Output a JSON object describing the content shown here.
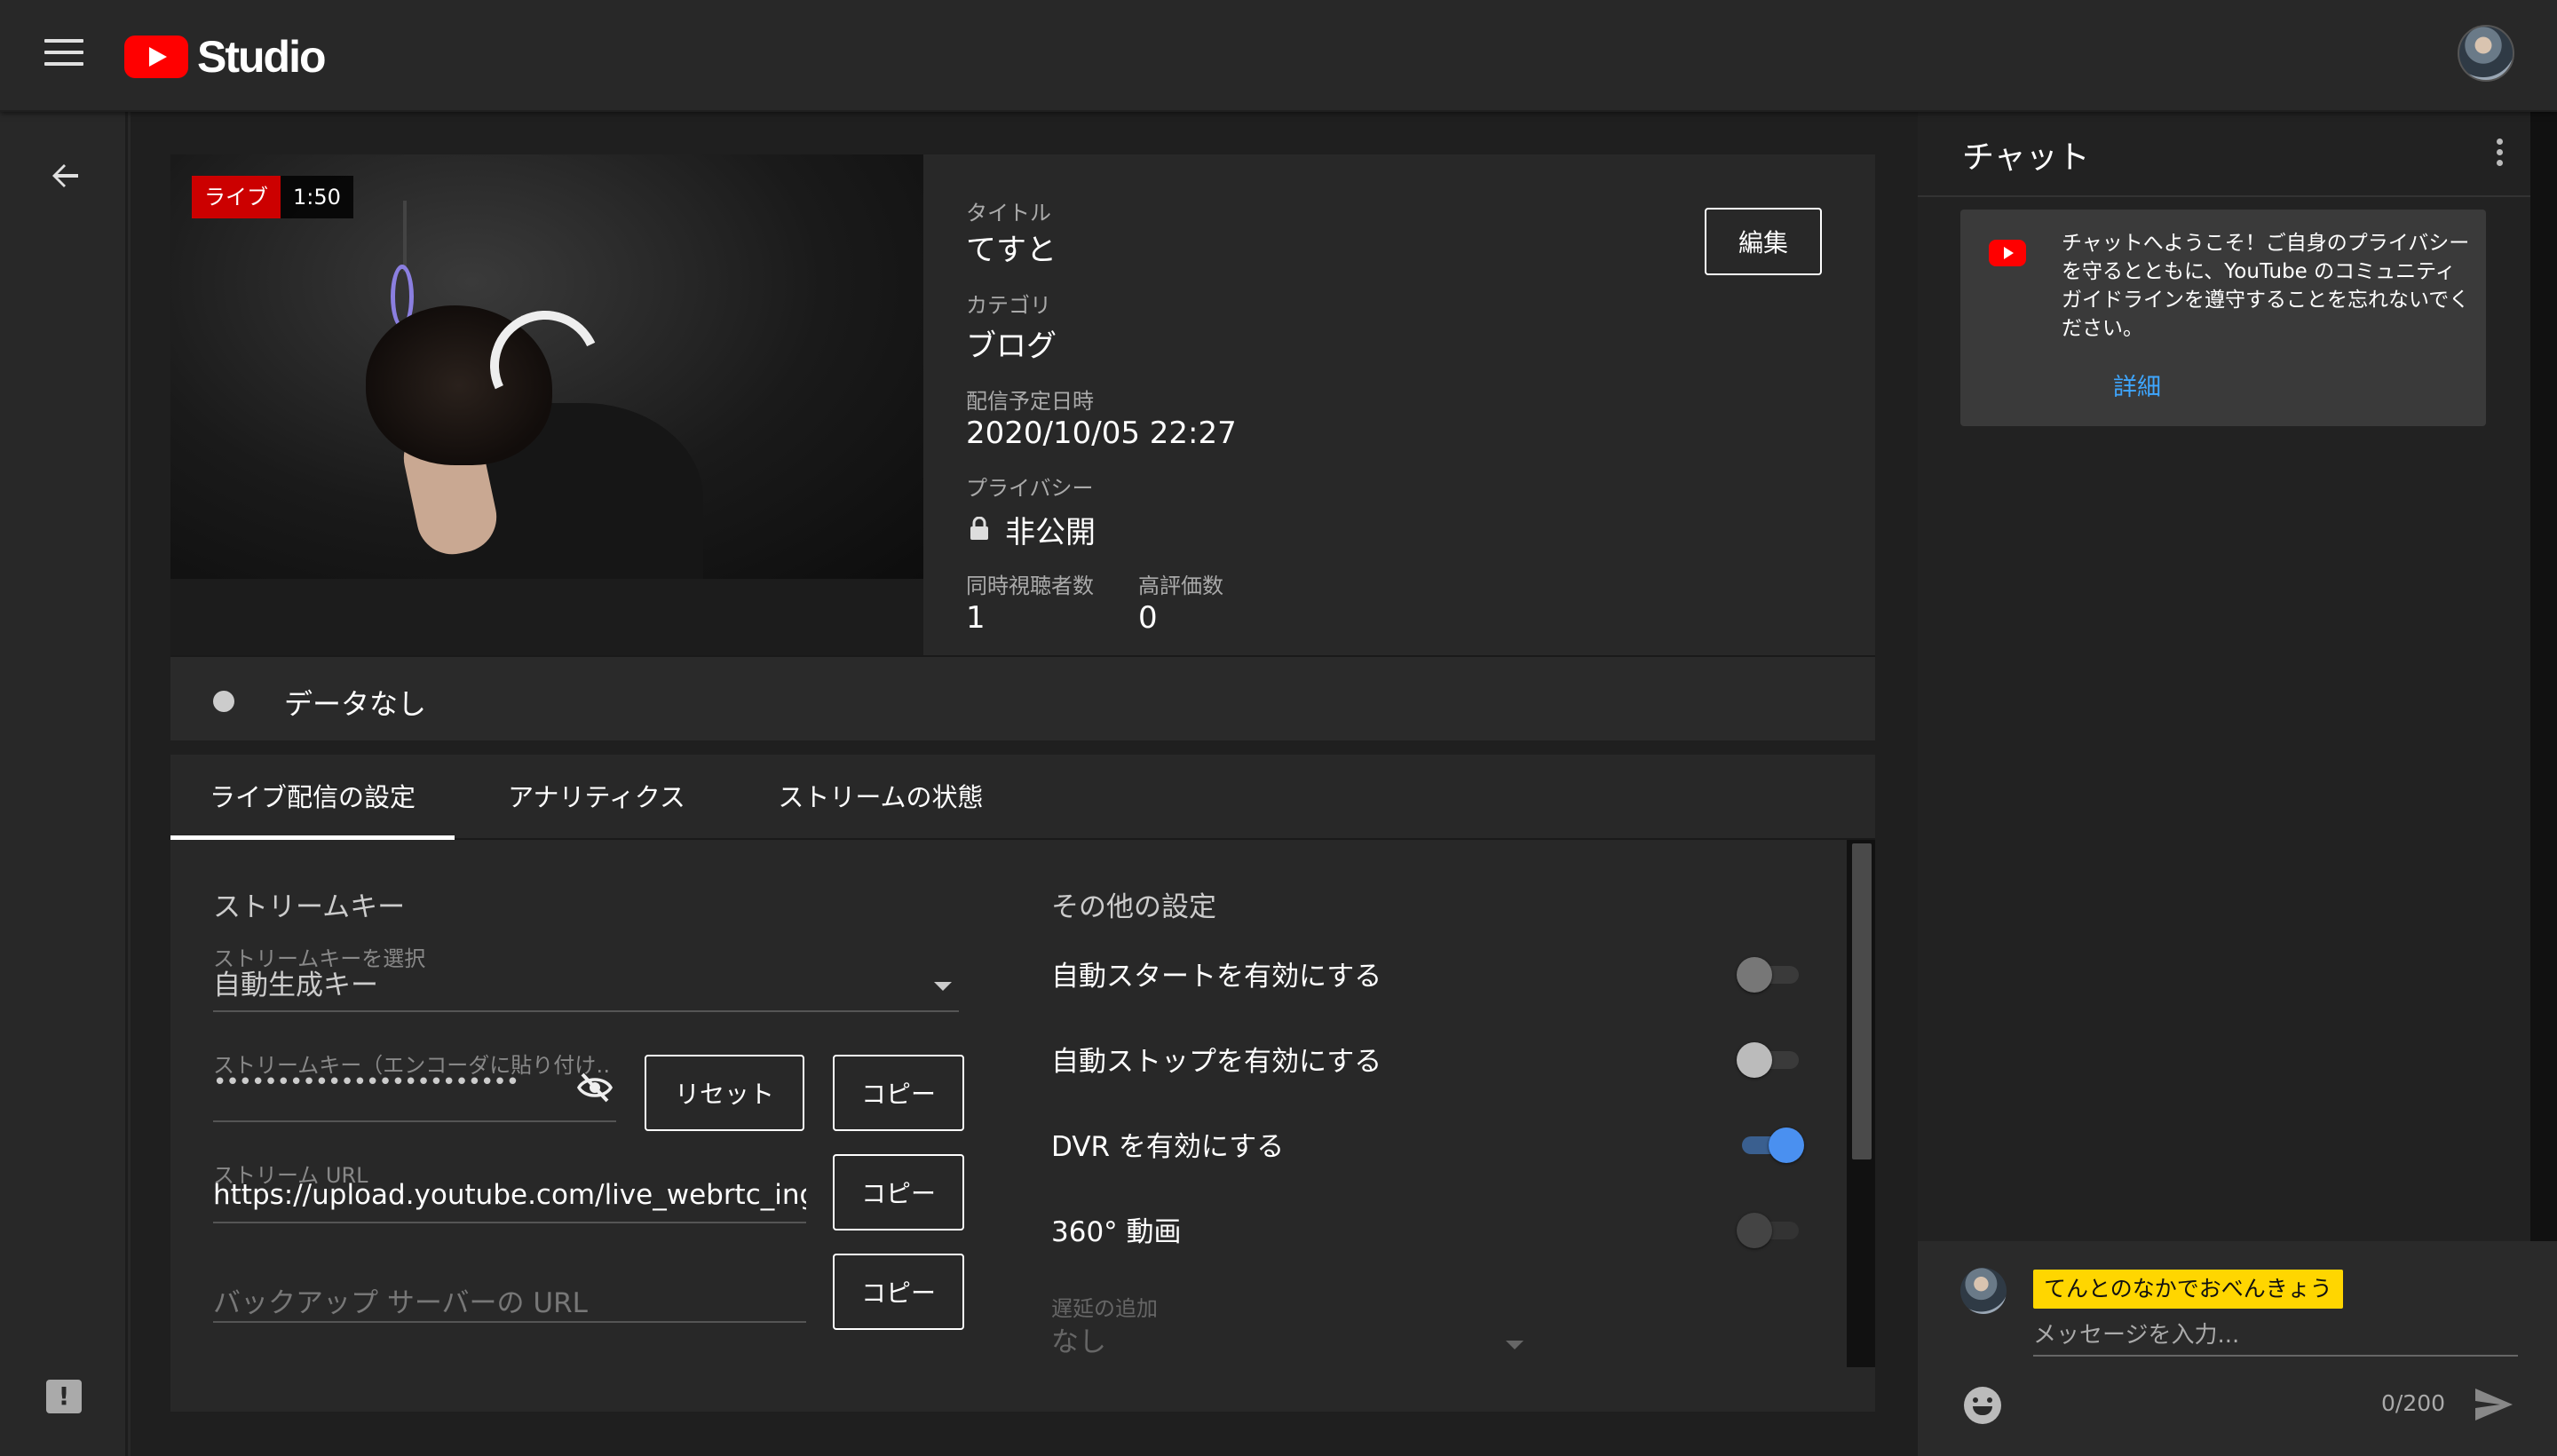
{
  "app": {
    "logo_text": "Studio"
  },
  "preview": {
    "live_label": "ライブ",
    "live_time": "1:50"
  },
  "info": {
    "title_label": "タイトル",
    "title_value": "てすと",
    "category_label": "カテゴリ",
    "category_value": "ブログ",
    "schedule_label": "配信予定日時",
    "schedule_value": "2020/10/05 22:27",
    "privacy_label": "プライバシー",
    "privacy_value": "非公開",
    "viewers_label": "同時視聴者数",
    "viewers_value": "1",
    "likes_label": "高評価数",
    "likes_value": "0",
    "edit_label": "編集"
  },
  "health": {
    "status_text": "データなし"
  },
  "tabs": [
    {
      "label": "ライブ配信の設定",
      "active": true
    },
    {
      "label": "アナリティクス",
      "active": false
    },
    {
      "label": "ストリームの状態",
      "active": false
    }
  ],
  "stream_key": {
    "section_title": "ストリームキー",
    "select_label": "ストリームキーを選択",
    "select_value": "自動生成キー",
    "key_label": "ストリームキー（エンコーダに貼り付け…",
    "key_value": "••••••••••••••••••••••••",
    "reset_label": "リセット",
    "copy_label": "コピー",
    "url_label": "ストリーム URL",
    "url_value": "https://upload.youtube.com/live_webrtc_ingest",
    "backup_placeholder": "バックアップ サーバーの URL"
  },
  "other_settings": {
    "section_title": "その他の設定",
    "toggles": [
      {
        "label": "自動スタートを有効にする",
        "on": false
      },
      {
        "label": "自動ストップを有効にする",
        "on": false
      },
      {
        "label": "DVR を有効にする",
        "on": true
      },
      {
        "label": "360° 動画",
        "on": false
      }
    ],
    "latency_label": "遅延の追加",
    "latency_value": "なし"
  },
  "chat": {
    "title": "チャット",
    "welcome_text": "チャットへようこそ！ご自身のプライバシーを守るとともに、YouTube のコミュニティ ガイドラインを遵守することを忘れないでください。",
    "welcome_link": "詳細",
    "user_name": "てんとのなかでおべんきょう",
    "input_placeholder": "メッセージを入力...",
    "char_count": "0/200"
  },
  "colors": {
    "accent": "#3ea6ff",
    "live_red": "#cc0000",
    "toggle_on": "#4a90f0",
    "name_highlight": "#ffd600"
  }
}
